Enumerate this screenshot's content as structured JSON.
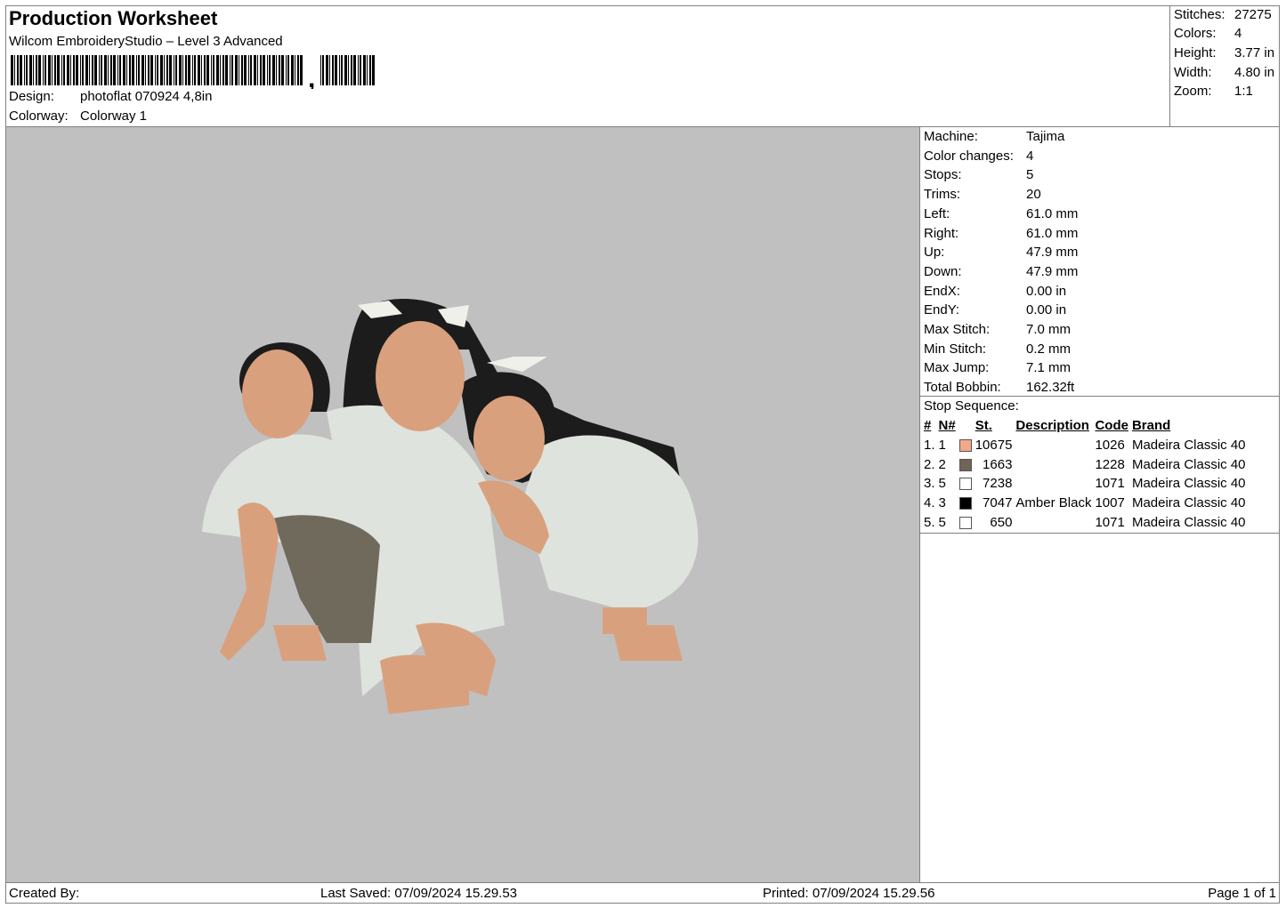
{
  "header": {
    "title": "Production Worksheet",
    "subtitle": "Wilcom EmbroideryStudio – Level 3 Advanced",
    "design_label": "Design:",
    "design_value": "photoflat 070924 4,8in",
    "colorway_label": "Colorway:",
    "colorway_value": "Colorway 1"
  },
  "summary": [
    {
      "label": "Stitches:",
      "value": "27275"
    },
    {
      "label": "Colors:",
      "value": "4"
    },
    {
      "label": "Height:",
      "value": "3.77 in"
    },
    {
      "label": "Width:",
      "value": "4.80 in"
    },
    {
      "label": "Zoom:",
      "value": "1:1"
    }
  ],
  "machine_info": [
    {
      "label": "Machine:",
      "value": "Tajima"
    },
    {
      "label": "Color changes:",
      "value": "4"
    },
    {
      "label": "Stops:",
      "value": "5"
    },
    {
      "label": "Trims:",
      "value": "20"
    },
    {
      "label": "Left:",
      "value": "61.0 mm"
    },
    {
      "label": "Right:",
      "value": "61.0 mm"
    },
    {
      "label": "Up:",
      "value": "47.9 mm"
    },
    {
      "label": "Down:",
      "value": "47.9 mm"
    },
    {
      "label": "EndX:",
      "value": "0.00 in"
    },
    {
      "label": "EndY:",
      "value": "0.00 in"
    },
    {
      "label": "Max Stitch:",
      "value": "7.0 mm"
    },
    {
      "label": "Min Stitch:",
      "value": "0.2 mm"
    },
    {
      "label": "Max Jump:",
      "value": "7.1 mm"
    },
    {
      "label": "Total Bobbin:",
      "value": "162.32ft"
    }
  ],
  "stop_sequence": {
    "title": "Stop Sequence:",
    "columns": [
      "#",
      "N#",
      "St.",
      "Description",
      "Code",
      "Brand"
    ],
    "rows": [
      {
        "num": "1.",
        "n": "1",
        "color": "#f2a98a",
        "st": "10675",
        "desc": "",
        "code": "1026",
        "brand": "Madeira Classic 40"
      },
      {
        "num": "2.",
        "n": "2",
        "color": "#706457",
        "st": "1663",
        "desc": "",
        "code": "1228",
        "brand": "Madeira Classic 40"
      },
      {
        "num": "3.",
        "n": "5",
        "color": "#ffffff",
        "st": "7238",
        "desc": "",
        "code": "1071",
        "brand": "Madeira Classic 40"
      },
      {
        "num": "4.",
        "n": "3",
        "color": "#000000",
        "st": "7047",
        "desc": "Amber Black",
        "code": "1007",
        "brand": "Madeira Classic 40"
      },
      {
        "num": "5.",
        "n": "5",
        "color": "#ffffff",
        "st": "650",
        "desc": "",
        "code": "1071",
        "brand": "Madeira Classic 40"
      }
    ]
  },
  "footer": {
    "created_by": "Created By:",
    "last_saved": "Last Saved: 07/09/2024 15.29.53",
    "printed": "Printed: 07/09/2024 15.29.56",
    "page": "Page 1 of 1"
  },
  "colors": {
    "preview_bg": "#c0c0c0",
    "skin": "#d9a07e",
    "hair": "#1c1c1c",
    "cloth_light": "#dfe3dd",
    "cloth_dark": "#6f6a5c"
  }
}
